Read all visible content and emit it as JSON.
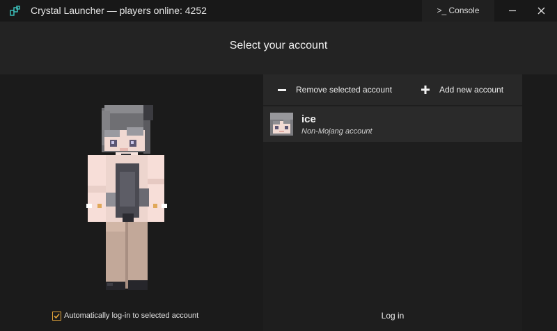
{
  "window": {
    "title": "Crystal Launcher — players online: 4252",
    "console_label": ">_ Console",
    "accent": "#3ec6c0"
  },
  "header": {
    "title": "Select your account"
  },
  "actions": {
    "remove_label": "Remove selected account",
    "add_label": "Add new account"
  },
  "accounts": [
    {
      "name": "ice",
      "type": "Non-Mojang account",
      "selected": true
    }
  ],
  "auto_login": {
    "label": "Automatically log-in to selected account",
    "checked": true,
    "accent": "#e2a33a"
  },
  "login_label": "Log in"
}
